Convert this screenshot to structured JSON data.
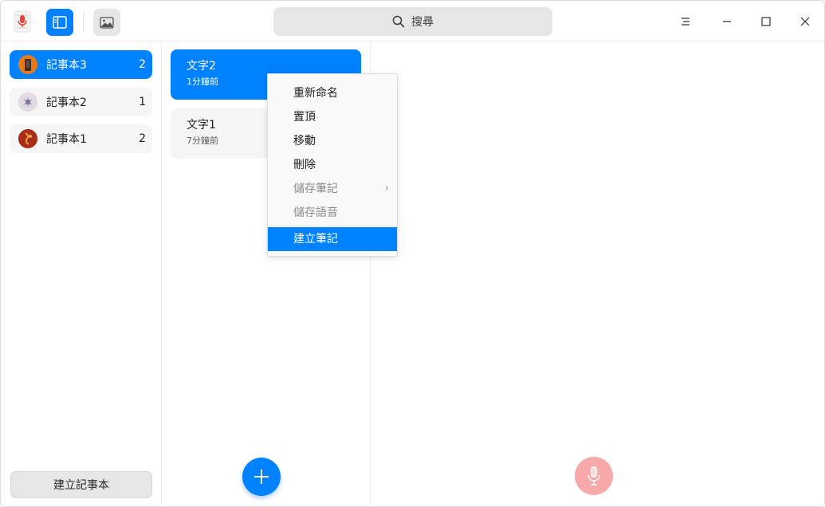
{
  "titlebar": {
    "search_label": "搜尋"
  },
  "notebooks": [
    {
      "name": "記事本3",
      "count": "2",
      "active": true
    },
    {
      "name": "記事本2",
      "count": "1",
      "active": false
    },
    {
      "name": "記事本1",
      "count": "2",
      "active": false
    }
  ],
  "create_notebook_label": "建立記事本",
  "notes": [
    {
      "title": "文字2",
      "time": "1分鐘前",
      "active": true
    },
    {
      "title": "文字1",
      "time": "7分鐘前",
      "active": false
    }
  ],
  "context_menu": {
    "items": [
      {
        "label": "重新命名",
        "state": "enabled"
      },
      {
        "label": "置頂",
        "state": "enabled"
      },
      {
        "label": "移動",
        "state": "enabled"
      },
      {
        "label": "刪除",
        "state": "enabled"
      },
      {
        "label": "儲存筆記",
        "state": "disabled",
        "submenu": true
      },
      {
        "label": "儲存語音",
        "state": "disabled"
      },
      {
        "label": "建立筆記",
        "state": "highlighted"
      }
    ]
  },
  "colors": {
    "accent": "#0081ff",
    "mic_button": "#f7a8a8",
    "item_bg": "#f5f5f5"
  }
}
